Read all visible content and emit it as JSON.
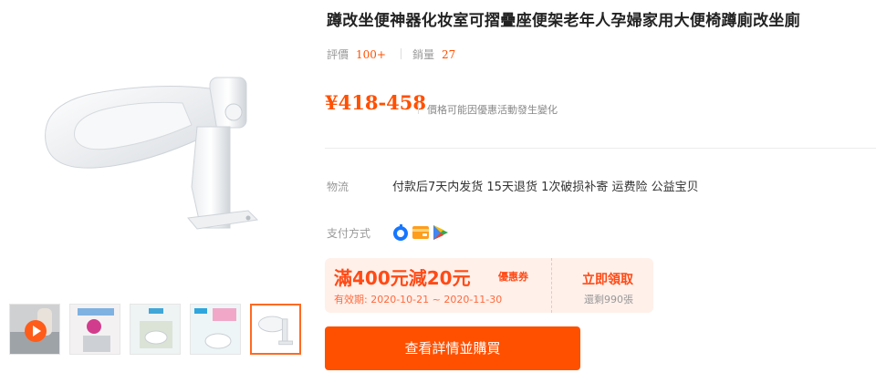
{
  "product": {
    "title": "蹲改坐便神器化妆室可摺疊座便架老年人孕婦家用大便椅蹲廁改坐廁",
    "image_alt": "白色折叠座便架",
    "thumbnails": [
      {
        "name": "video-thumb",
        "kind": "video"
      },
      {
        "name": "thumb-2",
        "kind": "image"
      },
      {
        "name": "thumb-3",
        "kind": "image"
      },
      {
        "name": "thumb-4",
        "kind": "image"
      },
      {
        "name": "thumb-5",
        "kind": "image",
        "selected": true
      }
    ]
  },
  "stats": {
    "rating_label": "評價",
    "rating_value": "100+",
    "sales_label": "銷量",
    "sales_value": "27"
  },
  "price": {
    "range": "¥418-458",
    "note": "價格可能因優惠活動發生變化"
  },
  "logistics": {
    "label": "物流",
    "value": "付款后7天内发货 15天退货 1次破损补寄 运费险 公益宝贝"
  },
  "payment": {
    "label": "支付方式",
    "icons": [
      "payment-app-icon",
      "card-wallet-icon",
      "play-store-pay-icon"
    ]
  },
  "coupon": {
    "amount": "滿400元減20元",
    "tag": "優惠券",
    "validity": "有效期: 2020-10-21 ~ 2020-11-30",
    "claim_label": "立即領取",
    "remaining": "還剩990張"
  },
  "buy_button": "查看詳情並購買",
  "colors": {
    "accent": "#ff5000",
    "coupon_bg": "#fff0ea",
    "coupon_text": "#ff4a16",
    "muted": "#999999"
  }
}
